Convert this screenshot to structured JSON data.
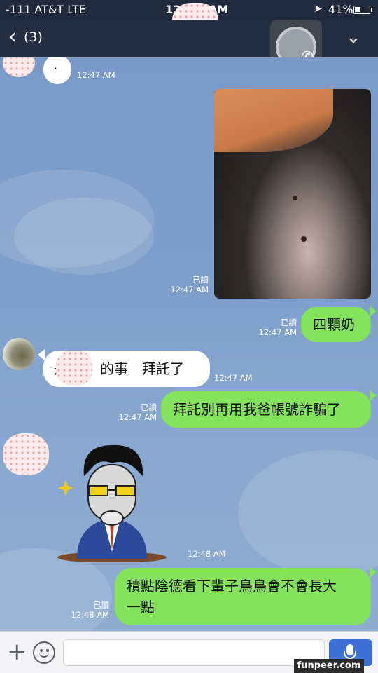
{
  "status_bar": {
    "carrier": "-111 AT&T  LTE",
    "time": "12:",
    "time_tail": "AM",
    "battery_pct": "41%"
  },
  "nav": {
    "back_icon": "chevron-left-icon",
    "unread_count": "(3)",
    "call_icon": "phone-icon",
    "menu_icon": "chevron-down-icon"
  },
  "messages": [
    {
      "side": "left",
      "text": "·",
      "time": "12:47 AM"
    },
    {
      "side": "right",
      "type": "photo",
      "read": "已讀",
      "time": "12:47 AM"
    },
    {
      "side": "right",
      "text": "四顆奶",
      "read": "已讀",
      "time": "12:47 AM"
    },
    {
      "side": "left",
      "text_a": "是",
      "text_b": "的事　拜託了",
      "time": "12:47 AM"
    },
    {
      "side": "right",
      "text": "拜託別再用我爸帳號詐騙了",
      "read": "已讀",
      "time": "12:47 AM"
    },
    {
      "side": "left",
      "type": "sticker",
      "time": "12:48 AM"
    },
    {
      "side": "right",
      "text_line1": "積點陰德看下輩子鳥鳥會不會長大",
      "text_line2": "一點",
      "read": "已讀",
      "time": "12:48 AM"
    }
  ],
  "input": {
    "placeholder": "",
    "plus_icon": "plus-icon",
    "emoji_icon": "smiley-icon",
    "mic_icon": "microphone-icon"
  },
  "watermark": "funpeer.com",
  "colors": {
    "green_bubble": "#84e25c",
    "white_bubble": "#ffffff",
    "chat_background": "#7f9fcb",
    "header": "#232d40",
    "mic_button": "#3d6fd6"
  }
}
